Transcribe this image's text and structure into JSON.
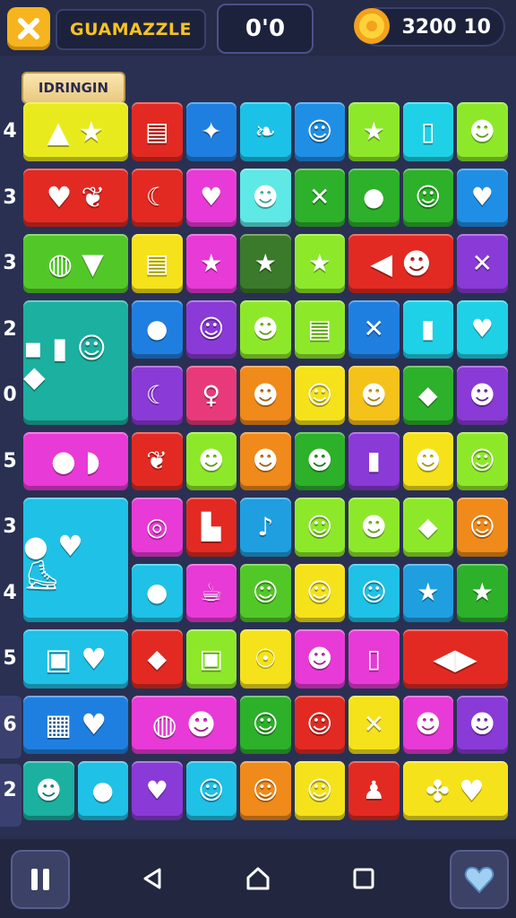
{
  "header": {
    "title": "GUAMAZZLE",
    "moves": "0'0",
    "score": "3200 10",
    "close_icon": "close-icon",
    "coin_icon": "gear-coin-icon"
  },
  "level_badge": "IDRINGIN",
  "row_labels": [
    "4",
    "3",
    "3",
    "2",
    "0",
    "5",
    "3",
    "4",
    "5",
    "6",
    "2"
  ],
  "tiles": [
    {
      "c": 0,
      "r": 0,
      "w": 2,
      "h": 1,
      "color": "#e9ea1e",
      "glyph": "▲ ★",
      "icon": "cone-star-icon"
    },
    {
      "c": 2,
      "r": 0,
      "color": "#e22a22",
      "glyph": "▤",
      "icon": "book-icon"
    },
    {
      "c": 3,
      "r": 0,
      "color": "#1f7fe0",
      "glyph": "✦",
      "icon": "rocket-icon"
    },
    {
      "c": 4,
      "r": 0,
      "color": "#1bc1e6",
      "glyph": "❧",
      "icon": "leaf-icon"
    },
    {
      "c": 5,
      "r": 0,
      "color": "#1f8fe6",
      "glyph": "☺",
      "icon": "face-icon"
    },
    {
      "c": 6,
      "r": 0,
      "color": "#8ee82a",
      "glyph": "★",
      "icon": "star-icon"
    },
    {
      "c": 7,
      "r": 0,
      "color": "#1fd1e6",
      "glyph": "▯",
      "icon": "box-icon"
    },
    {
      "c": 8,
      "r": 0,
      "color": "#8ee82a",
      "glyph": "☻",
      "icon": "monster-icon"
    },
    {
      "c": 0,
      "r": 1,
      "w": 2,
      "h": 1,
      "color": "#e22a22",
      "glyph": "♥ ❦",
      "icon": "apple-leaf-icon"
    },
    {
      "c": 2,
      "r": 1,
      "color": "#e22a22",
      "glyph": "☾",
      "icon": "moon-icon"
    },
    {
      "c": 3,
      "r": 1,
      "color": "#e83ad6",
      "glyph": "♥",
      "icon": "heart-icon"
    },
    {
      "c": 4,
      "r": 1,
      "color": "#5ee8e6",
      "glyph": "☻",
      "icon": "cat-icon"
    },
    {
      "c": 5,
      "r": 1,
      "color": "#2db02a",
      "glyph": "✕",
      "icon": "cross-icon"
    },
    {
      "c": 6,
      "r": 1,
      "color": "#2db02a",
      "glyph": "●",
      "icon": "balloon-icon"
    },
    {
      "c": 7,
      "r": 1,
      "color": "#2db02a",
      "glyph": "☺",
      "icon": "blob-icon"
    },
    {
      "c": 8,
      "r": 1,
      "color": "#1f8fe6",
      "glyph": "♥",
      "icon": "heart-icon"
    },
    {
      "c": 0,
      "r": 2,
      "w": 2,
      "h": 1,
      "color": "#52c828",
      "glyph": "◍ ▼",
      "icon": "ball-icon"
    },
    {
      "c": 2,
      "r": 2,
      "color": "#f5e21a",
      "glyph": "▤",
      "icon": "card-icon"
    },
    {
      "c": 3,
      "r": 2,
      "color": "#e83ad6",
      "glyph": "★",
      "icon": "star-icon"
    },
    {
      "c": 4,
      "r": 2,
      "color": "#3a7a2a",
      "glyph": "★",
      "icon": "star-icon"
    },
    {
      "c": 5,
      "r": 2,
      "color": "#8ee82a",
      "glyph": "★",
      "icon": "star-icon"
    },
    {
      "c": 6,
      "r": 2,
      "w": 2,
      "h": 1,
      "color": "#e22a22",
      "glyph": "◀ ☻",
      "icon": "kite-face-icon"
    },
    {
      "c": 8,
      "r": 2,
      "color": "#8a3ad6",
      "glyph": "✕",
      "icon": "tools-icon"
    },
    {
      "c": 0,
      "r": 3,
      "w": 2,
      "h": 2,
      "color": "#1bb0a0",
      "glyph": "▪ ▮ ☺ ◆",
      "icon": "fruit-group-icon"
    },
    {
      "c": 2,
      "r": 3,
      "color": "#1f7fe0",
      "glyph": "●",
      "icon": "apple-icon"
    },
    {
      "c": 3,
      "r": 3,
      "color": "#8a3ad6",
      "glyph": "☺",
      "icon": "mask-icon"
    },
    {
      "c": 4,
      "r": 3,
      "color": "#8ee82a",
      "glyph": "☻",
      "icon": "face-icon"
    },
    {
      "c": 5,
      "r": 3,
      "color": "#8ee82a",
      "glyph": "▤",
      "icon": "stripe-icon"
    },
    {
      "c": 6,
      "r": 3,
      "color": "#1f7fe0",
      "glyph": "✕",
      "icon": "cross-icon"
    },
    {
      "c": 7,
      "r": 3,
      "color": "#1fd1e6",
      "glyph": "▮",
      "icon": "battery-icon"
    },
    {
      "c": 8,
      "r": 3,
      "color": "#1fd1e6",
      "glyph": "♥",
      "icon": "heart-icon"
    },
    {
      "c": 2,
      "r": 4,
      "color": "#8a3ad6",
      "glyph": "☾",
      "icon": "moon-icon"
    },
    {
      "c": 3,
      "r": 4,
      "color": "#e83a7a",
      "glyph": "♀",
      "icon": "key-icon"
    },
    {
      "c": 4,
      "r": 4,
      "color": "#f08a1a",
      "glyph": "☻",
      "icon": "bear-icon"
    },
    {
      "c": 5,
      "r": 4,
      "color": "#f5e21a",
      "glyph": "☺",
      "icon": "face-icon"
    },
    {
      "c": 6,
      "r": 4,
      "color": "#f5c21a",
      "glyph": "☻",
      "icon": "bear-icon"
    },
    {
      "c": 7,
      "r": 4,
      "color": "#2db02a",
      "glyph": "◆",
      "icon": "gem-icon"
    },
    {
      "c": 8,
      "r": 4,
      "color": "#8a3ad6",
      "glyph": "☻",
      "icon": "bear-icon"
    },
    {
      "c": 0,
      "r": 5,
      "w": 2,
      "h": 1,
      "color": "#e83ad6",
      "glyph": "● ◗",
      "icon": "apple-drop-icon"
    },
    {
      "c": 2,
      "r": 5,
      "color": "#e22a22",
      "glyph": "❦",
      "icon": "leaf-icon"
    },
    {
      "c": 3,
      "r": 5,
      "color": "#8ee82a",
      "glyph": "☻",
      "icon": "cat-icon"
    },
    {
      "c": 4,
      "r": 5,
      "color": "#f08a1a",
      "glyph": "☻",
      "icon": "bear-icon"
    },
    {
      "c": 5,
      "r": 5,
      "color": "#2db02a",
      "glyph": "☻",
      "icon": "cat-icon"
    },
    {
      "c": 6,
      "r": 5,
      "color": "#8a3ad6",
      "glyph": "▮",
      "icon": "tool-icon"
    },
    {
      "c": 7,
      "r": 5,
      "color": "#f5e21a",
      "glyph": "☻",
      "icon": "elephant-icon"
    },
    {
      "c": 8,
      "r": 5,
      "color": "#8ee82a",
      "glyph": "☺",
      "icon": "face-icon"
    },
    {
      "c": 0,
      "r": 6,
      "w": 2,
      "h": 2,
      "color": "#1fc1e6",
      "glyph": "● ♥ ⛸",
      "icon": "shoe-icon"
    },
    {
      "c": 2,
      "r": 6,
      "color": "#e83ad6",
      "glyph": "◎",
      "icon": "ball-icon"
    },
    {
      "c": 3,
      "r": 6,
      "color": "#e22a22",
      "glyph": "▙",
      "icon": "block-icon"
    },
    {
      "c": 4,
      "r": 6,
      "color": "#1f9fe0",
      "glyph": "♪",
      "icon": "note-icon"
    },
    {
      "c": 5,
      "r": 6,
      "color": "#8ee82a",
      "glyph": "☺",
      "icon": "face-icon"
    },
    {
      "c": 6,
      "r": 6,
      "color": "#8ee82a",
      "glyph": "☻",
      "icon": "face-icon"
    },
    {
      "c": 7,
      "r": 6,
      "color": "#8ee82a",
      "glyph": "◆",
      "icon": "gem-icon"
    },
    {
      "c": 8,
      "r": 6,
      "color": "#f08a1a",
      "glyph": "☺",
      "icon": "face-icon"
    },
    {
      "c": 2,
      "r": 7,
      "color": "#1fc1e6",
      "glyph": "●",
      "icon": "coconut-icon"
    },
    {
      "c": 3,
      "r": 7,
      "color": "#e83ad6",
      "glyph": "☕",
      "icon": "teapot-icon"
    },
    {
      "c": 4,
      "r": 7,
      "color": "#52c828",
      "glyph": "☺",
      "icon": "face-icon"
    },
    {
      "c": 5,
      "r": 7,
      "color": "#f5e21a",
      "glyph": "☺",
      "icon": "face-icon"
    },
    {
      "c": 6,
      "r": 7,
      "color": "#1fc1e6",
      "glyph": "☺",
      "icon": "face-icon"
    },
    {
      "c": 7,
      "r": 7,
      "color": "#1f9fe0",
      "glyph": "★",
      "icon": "star-icon"
    },
    {
      "c": 8,
      "r": 7,
      "color": "#2db02a",
      "glyph": "★",
      "icon": "star-icon"
    },
    {
      "c": 0,
      "r": 8,
      "w": 2,
      "h": 1,
      "color": "#1fc1e6",
      "glyph": "▣ ♥",
      "icon": "box-heart-icon"
    },
    {
      "c": 2,
      "r": 8,
      "color": "#e22a22",
      "glyph": "◆",
      "icon": "leaf-icon"
    },
    {
      "c": 3,
      "r": 8,
      "color": "#8ee82a",
      "glyph": "▣",
      "icon": "device-icon"
    },
    {
      "c": 4,
      "r": 8,
      "color": "#f5e21a",
      "glyph": "☉",
      "icon": "medal-icon"
    },
    {
      "c": 5,
      "r": 8,
      "color": "#e83ad6",
      "glyph": "☻",
      "icon": "bear-icon"
    },
    {
      "c": 6,
      "r": 8,
      "color": "#e83ad6",
      "glyph": "▯",
      "icon": "jar-icon"
    },
    {
      "c": 7,
      "r": 8,
      "w": 2,
      "h": 1,
      "color": "#e22a22",
      "glyph": "◀▶",
      "icon": "candy-icon"
    },
    {
      "c": 0,
      "r": 9,
      "w": 2,
      "h": 1,
      "color": "#1f7fe0",
      "glyph": "▦ ♥",
      "icon": "robot-heart-icon"
    },
    {
      "c": 2,
      "r": 9,
      "w": 2,
      "h": 1,
      "color": "#e83ad6",
      "glyph": "◍ ☻",
      "icon": "leaf-face-icon"
    },
    {
      "c": 4,
      "r": 9,
      "color": "#2db02a",
      "glyph": "☺",
      "icon": "face-icon"
    },
    {
      "c": 5,
      "r": 9,
      "color": "#e22a22",
      "glyph": "☺",
      "icon": "face-icon"
    },
    {
      "c": 6,
      "r": 9,
      "color": "#f5e21a",
      "glyph": "✕",
      "icon": "cross-icon"
    },
    {
      "c": 7,
      "r": 9,
      "color": "#e83ad6",
      "glyph": "☻",
      "icon": "bear-icon"
    },
    {
      "c": 8,
      "r": 9,
      "color": "#8a3ad6",
      "glyph": "☻",
      "icon": "bear-icon"
    },
    {
      "c": 0,
      "r": 10,
      "color": "#1bb0a0",
      "glyph": "☻",
      "icon": "cat-icon"
    },
    {
      "c": 1,
      "r": 10,
      "color": "#1fc1e6",
      "glyph": "●",
      "icon": "tomato-icon"
    },
    {
      "c": 2,
      "r": 10,
      "color": "#8a3ad6",
      "glyph": "♥",
      "icon": "apple-icon"
    },
    {
      "c": 3,
      "r": 10,
      "color": "#1fc1e6",
      "glyph": "☺",
      "icon": "face-icon"
    },
    {
      "c": 4,
      "r": 10,
      "color": "#f08a1a",
      "glyph": "☺",
      "icon": "face-icon"
    },
    {
      "c": 5,
      "r": 10,
      "color": "#f5e21a",
      "glyph": "☺",
      "icon": "face-icon"
    },
    {
      "c": 6,
      "r": 10,
      "color": "#e22a22",
      "glyph": "♟",
      "icon": "rocket-icon"
    },
    {
      "c": 7,
      "r": 10,
      "w": 2,
      "h": 1,
      "color": "#f5e21a",
      "glyph": "✤ ♥",
      "icon": "flower-heart-icon"
    }
  ],
  "nav": {
    "pause_icon": "pause-icon",
    "back_icon": "back-icon",
    "home_icon": "home-icon",
    "recents_icon": "recents-icon",
    "heart_icon": "heart-icon"
  }
}
